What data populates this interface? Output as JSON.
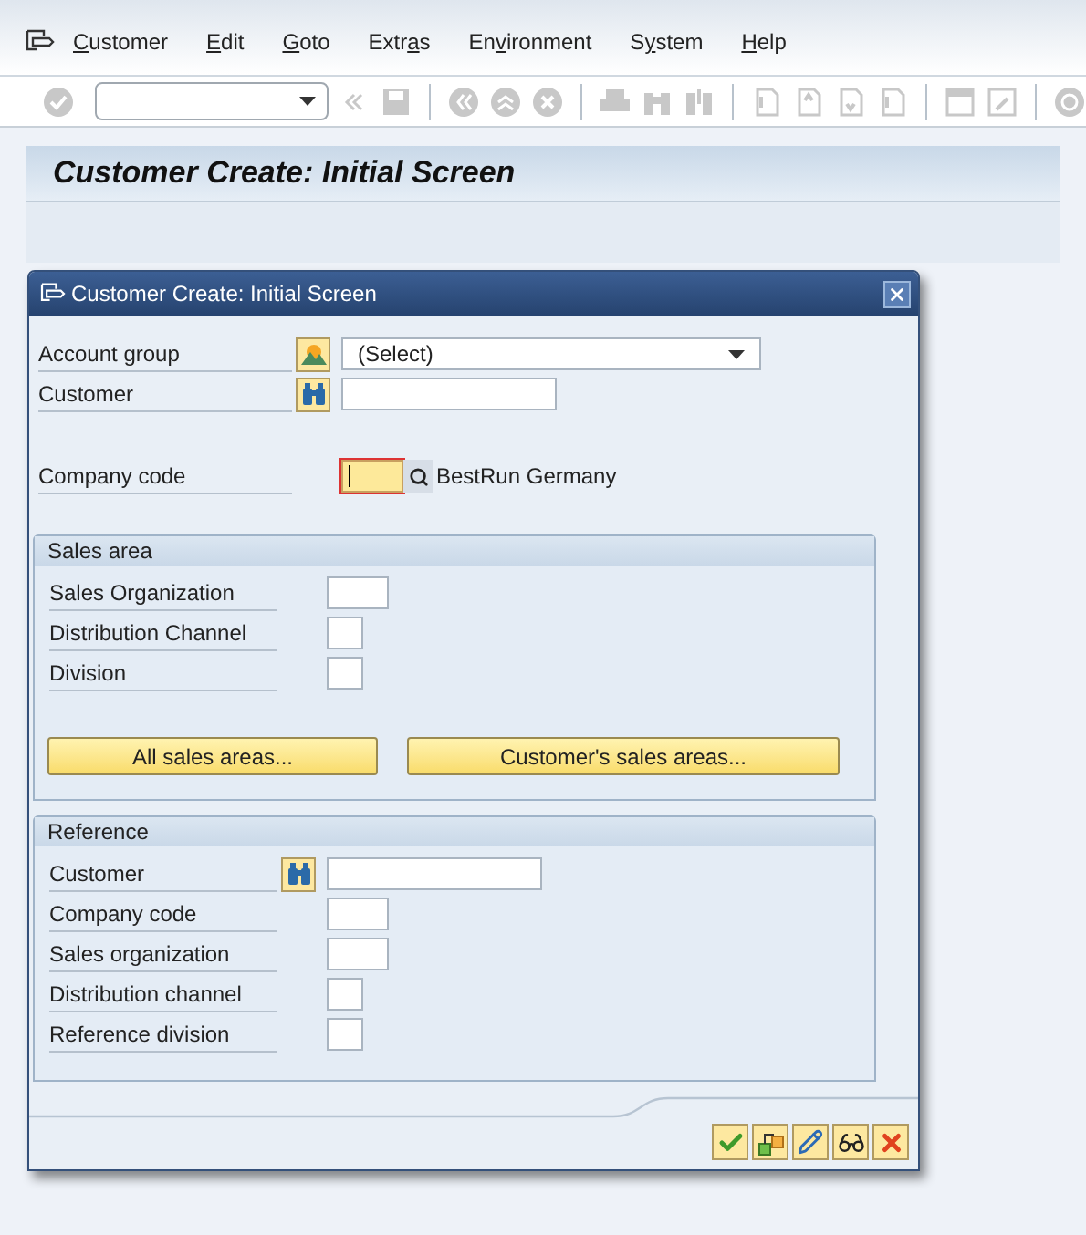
{
  "menu_bar": {
    "items": [
      {
        "access_key": "C",
        "after_key": "ustomer"
      },
      {
        "access_key": "E",
        "after_key": "dit"
      },
      {
        "access_key": "G",
        "after_key": "oto"
      },
      {
        "before_key": "Extr",
        "access_key": "a",
        "after_key": "s"
      },
      {
        "before_key": "En",
        "access_key": "v",
        "after_key": "ironment"
      },
      {
        "before_key": "S",
        "access_key": "y",
        "after_key": "stem"
      },
      {
        "access_key": "H",
        "after_key": "elp"
      }
    ]
  },
  "screen": {
    "title": "Customer Create: Initial Screen"
  },
  "dialog": {
    "title": "Customer Create: Initial Screen",
    "fields": [
      {
        "label": "Account group",
        "kind": "select_picker",
        "value": "(Select)",
        "focused": false
      },
      {
        "label": "Customer",
        "kind": "long_search",
        "focused": false
      },
      {
        "label": "Company code",
        "kind": "short_lookup",
        "focused": true,
        "description": "BestRun Germany"
      }
    ],
    "groups": [
      {
        "title": "Sales area",
        "fields": [
          {
            "label": "Sales Organization",
            "kind": "short",
            "focused": false
          },
          {
            "label": "Distribution Channel",
            "kind": "tiny",
            "focused": false
          },
          {
            "label": "Division",
            "kind": "tiny",
            "focused": false
          }
        ],
        "buttons": [
          "All sales areas...",
          "Customer's sales areas..."
        ]
      },
      {
        "title": "Reference",
        "fields": [
          {
            "label": "Customer",
            "kind": "long_search",
            "focused": false
          },
          {
            "label": "Company code",
            "kind": "short",
            "focused": false
          },
          {
            "label": "Sales organization",
            "kind": "short",
            "focused": false
          },
          {
            "label": "Distribution channel",
            "kind": "tiny",
            "focused": false
          },
          {
            "label": "Reference division",
            "kind": "tiny",
            "focused": false
          }
        ]
      }
    ]
  }
}
